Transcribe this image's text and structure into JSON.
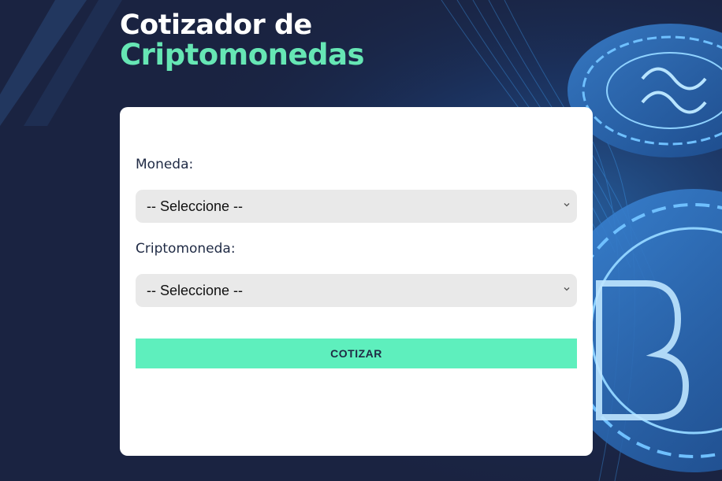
{
  "title": {
    "line1": "Cotizador de",
    "line2": "Criptomonedas"
  },
  "form": {
    "currency_label": "Moneda:",
    "currency_value": "-- Seleccione --",
    "crypto_label": "Criptomoneda:",
    "crypto_value": "-- Seleccione --",
    "submit_label": "COTIZAR"
  },
  "colors": {
    "background": "#1a2341",
    "accent": "#66e6b4",
    "button": "#5eefbd",
    "card": "#ffffff",
    "select_bg": "#e9e9e9"
  },
  "icons": {
    "background": "crypto-coins-background",
    "select_arrow": "chevron-down-icon"
  }
}
